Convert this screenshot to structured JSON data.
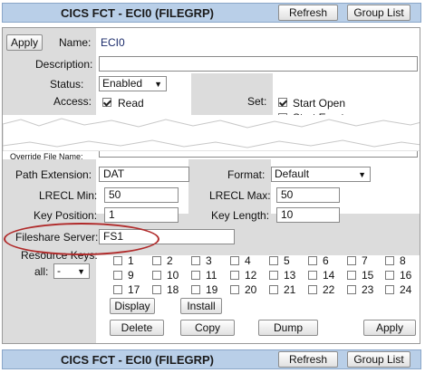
{
  "header": {
    "title": "CICS FCT - ECI0 (FILEGRP)",
    "refresh": "Refresh",
    "group_list": "Group List"
  },
  "form": {
    "apply_top": "Apply",
    "name_label": "Name:",
    "name_value": "ECI0",
    "description_label": "Description:",
    "status_label": "Status:",
    "status_value": "Enabled",
    "access_label": "Access:",
    "access_read": "Read",
    "set_label": "Set:",
    "set_start_open": "Start Open",
    "set_start_empty": "Start Empty",
    "override_label": "Override File Name:",
    "path_ext_label": "Path Extension:",
    "path_ext_value": "DAT",
    "format_label": "Format:",
    "format_value": "Default",
    "lrecl_min_label": "LRECL Min:",
    "lrecl_min_value": "50",
    "lrecl_max_label": "LRECL Max:",
    "lrecl_max_value": "50",
    "key_pos_label": "Key Position:",
    "key_pos_value": "1",
    "key_len_label": "Key Length:",
    "key_len_value": "10",
    "fileshare_label": "Fileshare Server:",
    "fileshare_value": "FS1",
    "resource_keys_label": "Resource Keys:",
    "all_label": "all:",
    "all_value": "-",
    "keys": [
      "1",
      "2",
      "3",
      "4",
      "5",
      "6",
      "7",
      "8",
      "9",
      "10",
      "11",
      "12",
      "13",
      "14",
      "15",
      "16",
      "17",
      "18",
      "19",
      "20",
      "21",
      "22",
      "23",
      "24"
    ],
    "display": "Display",
    "install": "Install",
    "delete": "Delete",
    "copy": "Copy",
    "dump": "Dump",
    "apply_bottom": "Apply"
  },
  "colors": {
    "header_bg": "#b9cfe8",
    "gray_panel": "#dcdcdc",
    "highlight_oval": "#b02a2a"
  }
}
